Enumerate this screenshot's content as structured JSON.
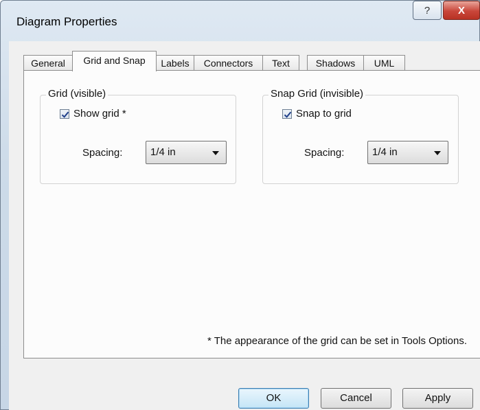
{
  "window": {
    "title": "Diagram Properties",
    "help_label": "?",
    "close_label": "X"
  },
  "tabs": [
    {
      "label": "General",
      "active": false
    },
    {
      "label": "Grid and Snap",
      "active": true
    },
    {
      "label": "Labels",
      "active": false
    },
    {
      "label": "Connectors",
      "active": false
    },
    {
      "label": "Text",
      "active": false
    },
    {
      "label": "Shadows",
      "active": false
    },
    {
      "label": "UML",
      "active": false
    }
  ],
  "grid_group": {
    "title": "Grid (visible)",
    "checkbox_label": "Show grid *",
    "checked": true,
    "spacing_label": "Spacing:",
    "spacing_value": "1/4 in"
  },
  "snap_group": {
    "title": "Snap Grid (invisible)",
    "checkbox_label": "Snap to grid",
    "checked": true,
    "spacing_label": "Spacing:",
    "spacing_value": "1/4 in"
  },
  "footnote": "* The appearance of the grid can be set in Tools Options.",
  "buttons": {
    "ok": "OK",
    "cancel": "Cancel",
    "apply": "Apply"
  },
  "colors": {
    "title_bar": "#cddbe9",
    "close_button": "#c9463a",
    "default_button_border": "#3c7fb1",
    "checkmark": "#1f3f8a"
  }
}
